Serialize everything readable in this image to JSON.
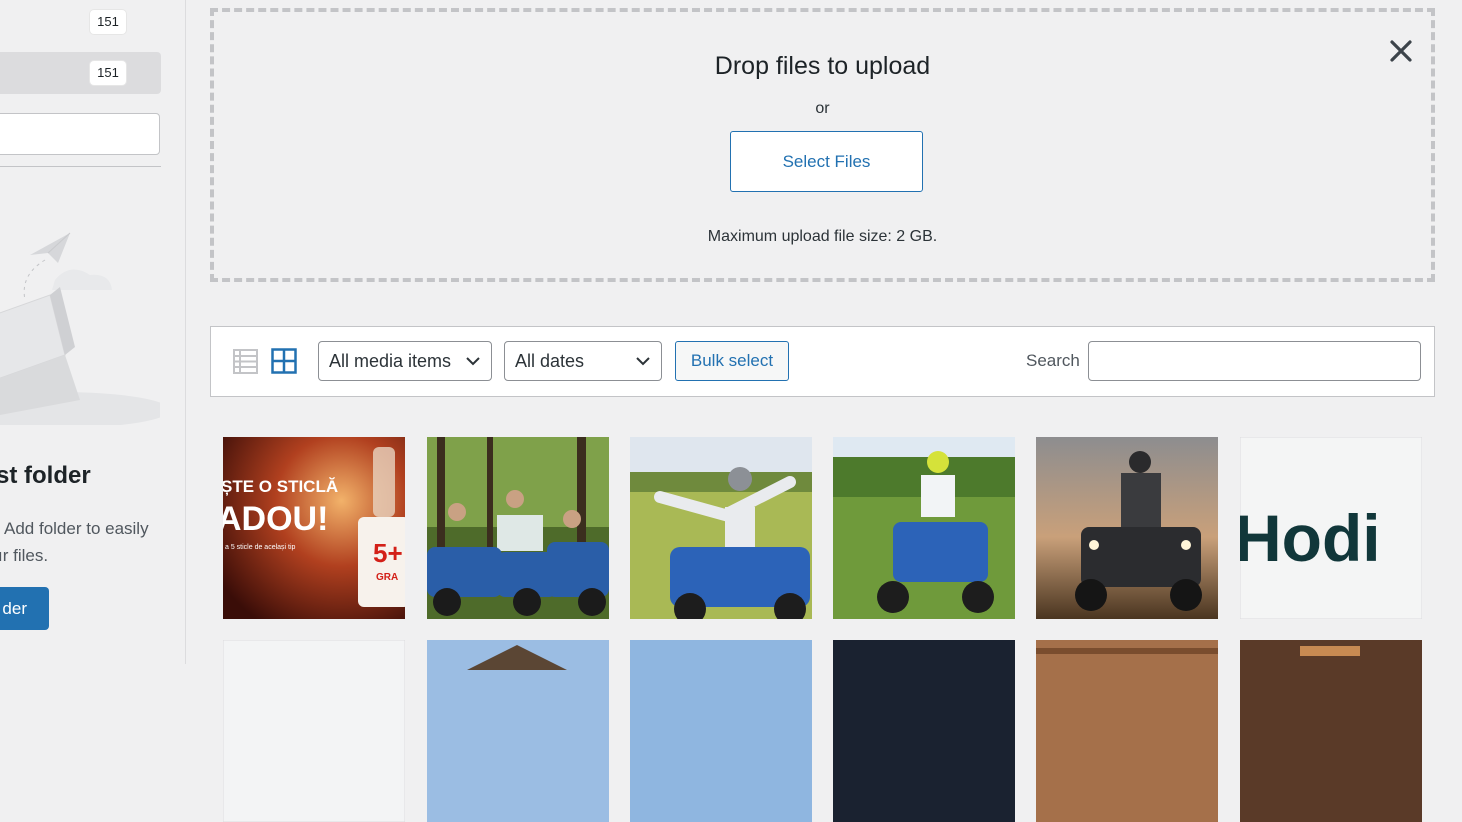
{
  "sidebar": {
    "counts": [
      "151",
      "151"
    ],
    "empty_state": {
      "title": "st folder",
      "desc_line1": "Add folder to easily",
      "desc_line2": "ır files.",
      "button_label": "der"
    }
  },
  "upload": {
    "title": "Drop files to upload",
    "or": "or",
    "select_button": "Select Files",
    "max_size": "Maximum upload file size: 2 GB."
  },
  "toolbar": {
    "type_filter": "All media items",
    "date_filter": "All dates",
    "bulk_select": "Bulk select",
    "search_label": "Search",
    "search_value": ""
  },
  "thumbnail_text": {
    "promo_line1": "ȘTE O STICLĂ",
    "promo_line2": "ADOU!",
    "promo_small": "a 5 sticle de același tip",
    "promo_tag": "5+",
    "promo_tag2": "GRA",
    "logo_text": "Hodi"
  },
  "colors": {
    "accent": "#2271b1",
    "text": "#1d2327",
    "background": "#f0f0f1"
  }
}
